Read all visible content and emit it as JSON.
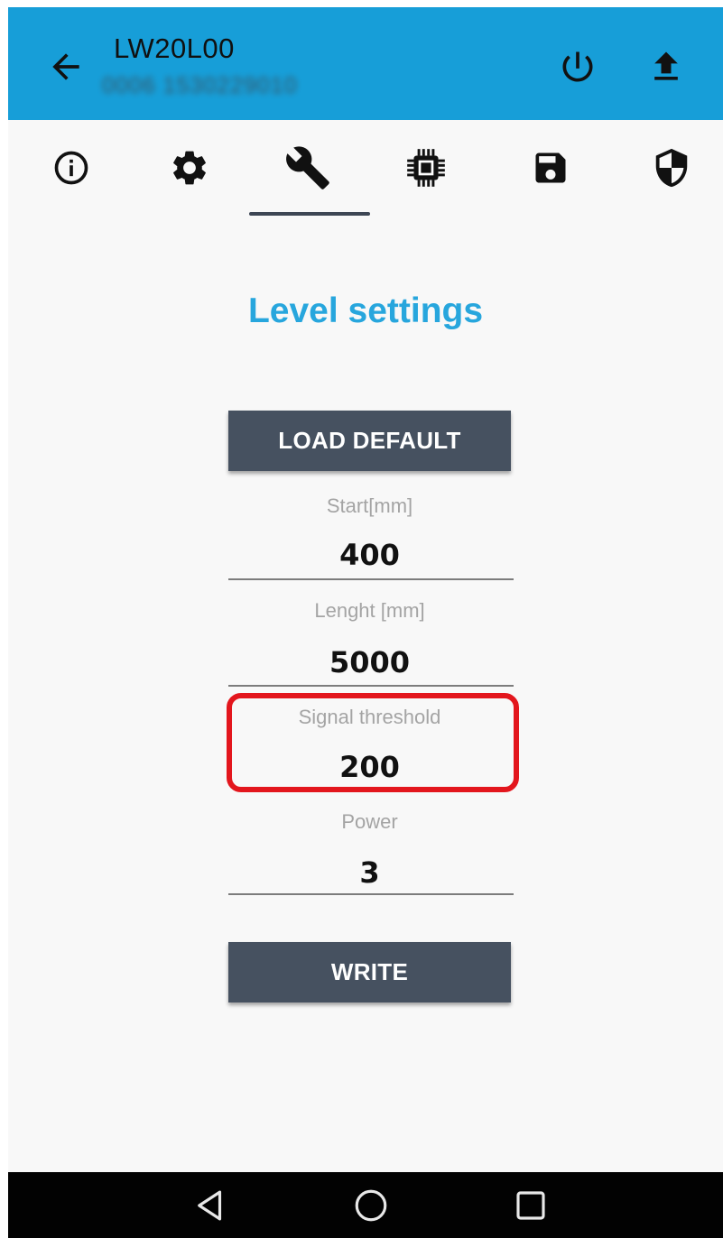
{
  "app_bar": {
    "title": "LW20L00",
    "subtitle": "0006 1530229010",
    "background": "#179ed8"
  },
  "icons": {
    "back": "arrow-back-icon",
    "power": "power-icon",
    "upload": "upload-icon",
    "tabs": [
      "info-icon",
      "settings-gear-icon",
      "wrench-icon",
      "chip-icon",
      "save-floppy-icon",
      "shield-icon"
    ],
    "nav": [
      "back-triangle-icon",
      "home-circle-icon",
      "recents-square-icon"
    ]
  },
  "tabs": {
    "selected": "wrench-icon"
  },
  "content": {
    "title": "Level settings",
    "title_color": "#27a6dd",
    "load_default_label": "LOAD DEFAULT",
    "write_label": "WRITE",
    "button_color": "#465160",
    "highlight_color": "#e3161d",
    "fields": {
      "start": {
        "label": "Start[mm]",
        "value": "400"
      },
      "length": {
        "label": "Lenght [mm]",
        "value": "5000"
      },
      "signal_threshold": {
        "label": "Signal threshold",
        "value": "200"
      },
      "power": {
        "label": "Power",
        "value": "3"
      }
    }
  }
}
